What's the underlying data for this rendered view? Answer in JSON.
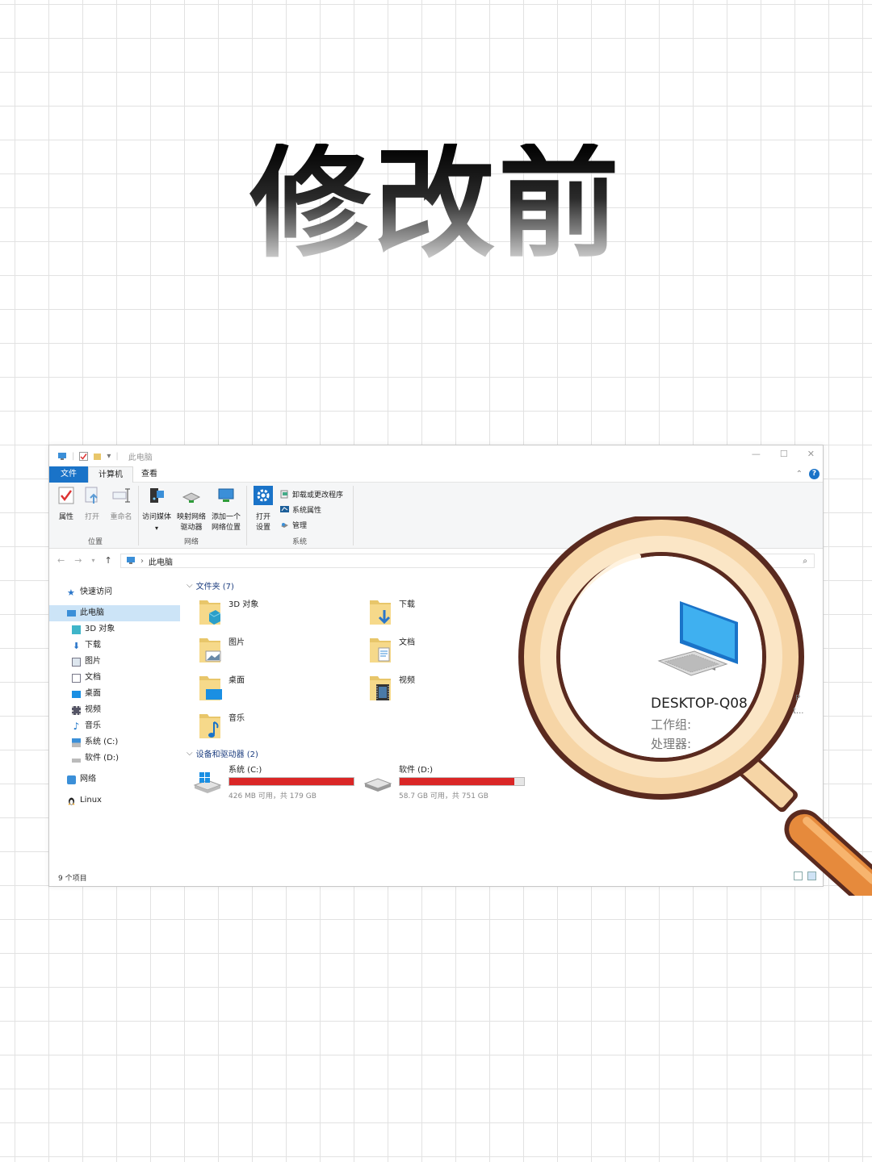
{
  "headline": "修改前",
  "window": {
    "title": "此电脑",
    "controls": {
      "minimize": "—",
      "maximize": "☐",
      "close": "✕"
    }
  },
  "menu": {
    "file": "文件",
    "computer": "计算机",
    "view": "查看",
    "help": "?"
  },
  "ribbon": {
    "properties": "属性",
    "open": "打开",
    "rename": "重命名",
    "group_location": "位置",
    "media_line1": "访问媒体",
    "map_line1": "映射网络",
    "map_line2": "驱动器",
    "addnet_line1": "添加一个",
    "addnet_line2": "网络位置",
    "group_network": "网络",
    "settings_line1": "打开",
    "settings_line2": "设置",
    "uninstall": "卸载或更改程序",
    "sys_props": "系统属性",
    "manage": "管理",
    "group_system": "系统"
  },
  "address": {
    "path": "此电脑"
  },
  "sidebar": {
    "items": [
      {
        "label": "快速访问",
        "icon": "star-icon"
      },
      {
        "label": "此电脑",
        "icon": "computer-icon"
      },
      {
        "label": "3D 对象",
        "icon": "cube-icon"
      },
      {
        "label": "下载",
        "icon": "download-icon"
      },
      {
        "label": "图片",
        "icon": "pictures-icon"
      },
      {
        "label": "文档",
        "icon": "documents-icon"
      },
      {
        "label": "桌面",
        "icon": "desktop-icon"
      },
      {
        "label": "视频",
        "icon": "video-icon"
      },
      {
        "label": "音乐",
        "icon": "music-icon"
      },
      {
        "label": "系统 (C:)",
        "icon": "drive-c-icon"
      },
      {
        "label": "软件 (D:)",
        "icon": "drive-d-icon"
      },
      {
        "label": "网络",
        "icon": "network-icon"
      },
      {
        "label": "Linux",
        "icon": "linux-icon"
      }
    ]
  },
  "folders_section": {
    "title": "文件夹 (7)"
  },
  "folders": [
    {
      "label": "3D 对象",
      "icon": "folder-3d-icon"
    },
    {
      "label": "下载",
      "icon": "folder-download-icon"
    },
    {
      "label": "图片",
      "icon": "folder-pictures-icon"
    },
    {
      "label": "文档",
      "icon": "folder-documents-icon"
    },
    {
      "label": "桌面",
      "icon": "folder-desktop-icon"
    },
    {
      "label": "视频",
      "icon": "folder-video-icon"
    },
    {
      "label": "音乐",
      "icon": "folder-music-icon"
    }
  ],
  "drives_section": {
    "title": "设备和驱动器 (2)"
  },
  "drives": [
    {
      "label": "系统 (C:)",
      "usage": "426 MB 可用，共 179 GB",
      "used_fraction": 0.998,
      "icon": "windows-drive-icon"
    },
    {
      "label": "软件 (D:)",
      "usage": "58.7 GB 可用，共 751 GB",
      "used_fraction": 0.92,
      "icon": "drive-icon"
    }
  ],
  "status": {
    "items": "9 个项目"
  },
  "magnifier": {
    "computer_name": "DESKTOP-Q08",
    "workgroup_label": "工作组:",
    "processor_label": "处理器:",
    "edge_text_1": "P",
    "edge_text_2": "t..."
  },
  "colors": {
    "accent": "#1a73c8",
    "drive_full": "#da2626",
    "lens_rim": "#f6d5a6",
    "lens_outline": "#5a2a1f",
    "handle": "#e68a3c"
  }
}
